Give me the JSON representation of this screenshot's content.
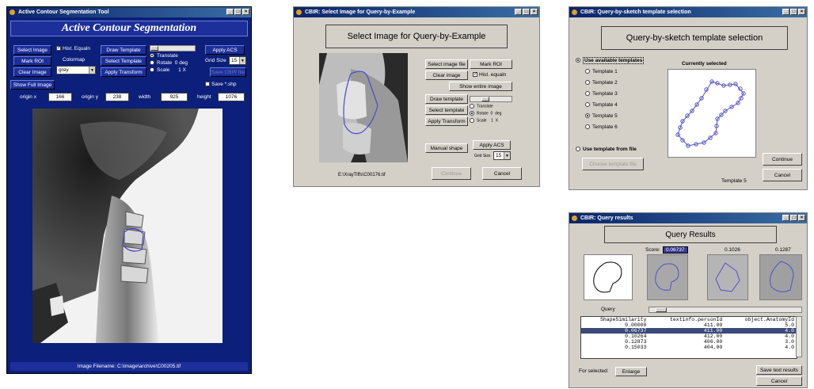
{
  "acs": {
    "window_title": "Active Contour Segmentation Tool",
    "header": "Active Contour Segmentation",
    "buttons": {
      "select_image": "Select Image",
      "mark_roi": "Mark ROI",
      "clear_image": "Clear Image",
      "show_full_image": "Show Full Image",
      "draw_template": "Draw Template",
      "select_template": "Select Template",
      "apply_transform": "Apply Transform",
      "apply_acs": "Apply ACS",
      "save_cbir": "Save CBIR file"
    },
    "hist_equaln": "Hist. Equaln",
    "colormap_label": "Colormap",
    "colormap_value": "grey",
    "radios": {
      "translate": "Translate",
      "rotate": "Rotate",
      "scale": "Scale"
    },
    "rotate_value": "0 deg",
    "scale_value": "1 X",
    "grid_size_label": "Grid Size",
    "grid_size_value": "15",
    "save_shp": "Save *.shp",
    "fields": [
      {
        "label": "origin x",
        "value": "166"
      },
      {
        "label": "origin y",
        "value": "238"
      },
      {
        "label": "width",
        "value": "925"
      },
      {
        "label": "height",
        "value": "1076"
      }
    ],
    "status": "Image Filename: C:\\image\\archive\\C00205.tif",
    "colors": {
      "background": "#0c1f7a",
      "button": "#1c2f9a"
    }
  },
  "qbe": {
    "window_title": "CBIR: Select Image for Query-by-Example",
    "header": "Select Image for Query-by-Example",
    "buttons": {
      "select_image_file": "Select image file",
      "mark_roi": "Mark ROI",
      "clear_image": "Clear image",
      "show_entire_image": "Show entire image",
      "draw_template": "Draw template",
      "select_template": "Select template",
      "apply_transform": "Apply Transform",
      "manual_shape": "Manual shape",
      "apply_acs": "Apply ACS",
      "continue": "Continue",
      "cancel": "Cancel"
    },
    "hist_equaln": "Hist. equaln",
    "radios": {
      "translate": "Translate",
      "rotate": "Rotate",
      "scale": "Scale"
    },
    "rotate_value": "0",
    "rotate_unit": "deg",
    "scale_value": "1",
    "scale_unit": "X",
    "grid_size_label": "Grid Size",
    "grid_size_value": "15",
    "filename": "E:\\XrayTiffs\\C00176.tif"
  },
  "sketch": {
    "window_title": "CBIR: Query-by-sketch template selection",
    "header": "Query-by-sketch template selection",
    "use_available": "Use available templates",
    "currently_selected": "Currently selected",
    "templates": [
      "Template 1",
      "Template 2",
      "Template 3",
      "Template 4",
      "Template 5",
      "Template 6"
    ],
    "selected_index": 4,
    "use_from_file": "Use template from file",
    "choose_template_file": "Choose template file",
    "continue": "Continue",
    "cancel": "Cancel",
    "caption": "Template 5"
  },
  "results": {
    "window_title": "CBIR: Query results",
    "header": "Query Results",
    "score_label": "Score:",
    "scores": [
      "0.06737",
      "0.1026",
      "0.1287"
    ],
    "query_label": "Query",
    "columns": [
      "ShapeSimilarity",
      "textinfo.personId",
      "object.AnatomyId"
    ],
    "rows": [
      [
        "0.00000",
        "411.00",
        "5.0"
      ],
      [
        "0.06737",
        "411.00",
        "4.0"
      ],
      [
        "0.10264",
        "412.00",
        "4.0"
      ],
      [
        "0.12873",
        "406.00",
        "3.0"
      ],
      [
        "0.15033",
        "404.00",
        "4.0"
      ]
    ],
    "selected_row": 1,
    "for_selected": "For selected:",
    "enlarge": "Enlarge",
    "save_text_results": "Save text results",
    "cancel": "Cancel"
  }
}
